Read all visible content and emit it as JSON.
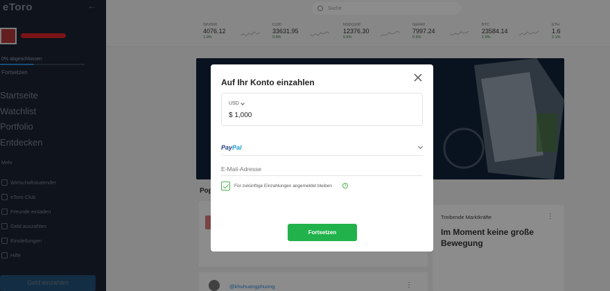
{
  "app": {
    "logo": "eToro",
    "collapse_icon": "arrow-left-icon"
  },
  "sidebar": {
    "progress_label": "0% abgeschlossen",
    "progress_fraction": 0.4,
    "continue_label": "Fortsetzen",
    "nav_main": [
      "Startseite",
      "Watchlist",
      "Portfolio",
      "Entdecken"
    ],
    "more_label": "Mehr",
    "nav_sub": [
      "Wirtschaftskalender",
      "eToro Club",
      "Freunde einladen",
      "Geld auszahlen",
      "Einstellungen",
      "Hilfe"
    ],
    "deposit_button": "Geld einzahlen"
  },
  "topbar": {
    "search_placeholder": "Suche"
  },
  "ticker": [
    {
      "sym": "SPX500",
      "val": "4076.12",
      "chg": "1.0%"
    },
    {
      "sym": "DJ30",
      "val": "33631.95",
      "chg": "0.9%"
    },
    {
      "sym": "NSDQ100",
      "val": "12376.30",
      "chg": "0.6%"
    },
    {
      "sym": "GER40",
      "val": "7997.24",
      "chg": "0.5%"
    },
    {
      "sym": "BTC",
      "val": "23584.14",
      "chg": "1.9%"
    },
    {
      "sym": "ETH",
      "val": "1.6",
      "chg": "2.1%"
    }
  ],
  "main": {
    "popular_label": "Pop",
    "right_card": {
      "title": "Treibende Marktkräfte",
      "text": "Im Moment keine große Bewegung"
    },
    "bottom_card_user": "@khuhuangphuong"
  },
  "modal": {
    "title": "Auf Ihr Konto einzahlen",
    "currency": "USD",
    "amount": "$ 1,000",
    "payment_method": {
      "part1": "Pay",
      "part2": "Pal"
    },
    "email_placeholder": "E-Mail-Adresse",
    "save_checkbox_label": "Für zukünftige Einzahlungen angemeldet bleiben",
    "save_checked": true,
    "continue_button": "Fortsetzen"
  },
  "colors": {
    "primary_green": "#21b24b",
    "sidebar_bg": "#1b2434",
    "accent_blue": "#2d8fd6"
  }
}
